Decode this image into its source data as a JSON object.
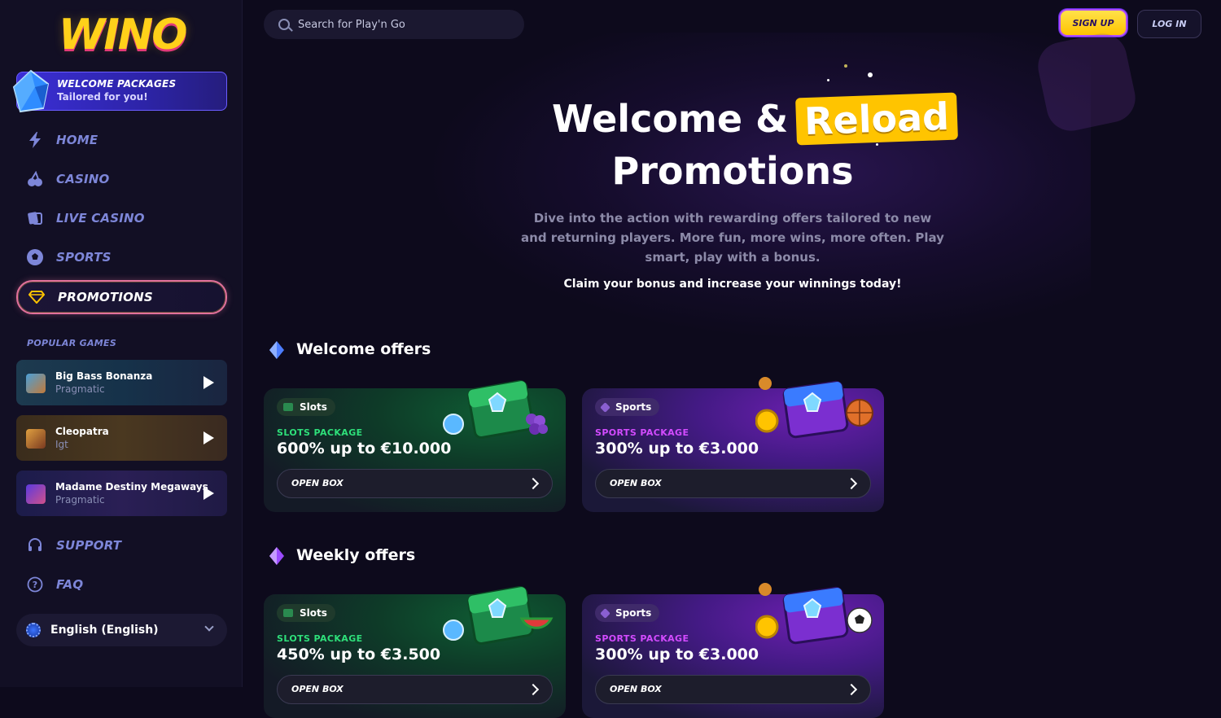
{
  "brand": {
    "logo_text": "WINO"
  },
  "sidebar": {
    "welcome": {
      "title": "WELCOME PACKAGES",
      "subtitle": "Tailored for you!"
    },
    "nav": [
      {
        "label": "HOME",
        "icon": "lightning-icon"
      },
      {
        "label": "CASINO",
        "icon": "cherries-icon"
      },
      {
        "label": "LIVE CASINO",
        "icon": "cards-icon"
      },
      {
        "label": "SPORTS",
        "icon": "soccer-ball-icon"
      },
      {
        "label": "PROMOTIONS",
        "icon": "diamond-icon",
        "active": true
      }
    ],
    "popular_label": "POPULAR GAMES",
    "games": [
      {
        "name": "Big Bass Bonanza",
        "provider": "Pragmatic"
      },
      {
        "name": "Cleopatra",
        "provider": "Igt"
      },
      {
        "name": "Madame Destiny Megaways",
        "provider": "Pragmatic"
      }
    ],
    "support": "SUPPORT",
    "faq": "FAQ",
    "language": "English (English)"
  },
  "header": {
    "search_placeholder": "Search for Play'n Go",
    "signup": "SIGN UP",
    "login": "LOG IN"
  },
  "hero": {
    "title_a": "Welcome &",
    "title_highlight": "Reload",
    "title_b": "Promotions",
    "description": "Dive into the action with rewarding offers tailored to new and returning players. More fun, more wins, more often. Play smart, play with a bonus.",
    "cta": "Claim your bonus and increase your winnings today!"
  },
  "sections": [
    {
      "title": "Welcome offers",
      "cards": [
        {
          "tag": "Slots",
          "package": "SLOTS PACKAGE",
          "amount": "600% up to €10.000",
          "button": "OPEN BOX"
        },
        {
          "tag": "Sports",
          "package": "SPORTS PACKAGE",
          "amount": "300% up to €3.000",
          "button": "OPEN BOX"
        }
      ]
    },
    {
      "title": "Weekly offers",
      "cards": [
        {
          "tag": "Slots",
          "package": "SLOTS PACKAGE",
          "amount": "450% up to €3.500",
          "button": "OPEN BOX"
        },
        {
          "tag": "Sports",
          "package": "SPORTS PACKAGE",
          "amount": "300% up to €3.000",
          "button": "OPEN BOX"
        }
      ]
    }
  ],
  "colors": {
    "accent_yellow": "#ffc400",
    "accent_purple": "#6a5cff",
    "nav_text": "#7d86d8",
    "slots_green": "#2ee07a",
    "sports_purple": "#d34bff"
  }
}
